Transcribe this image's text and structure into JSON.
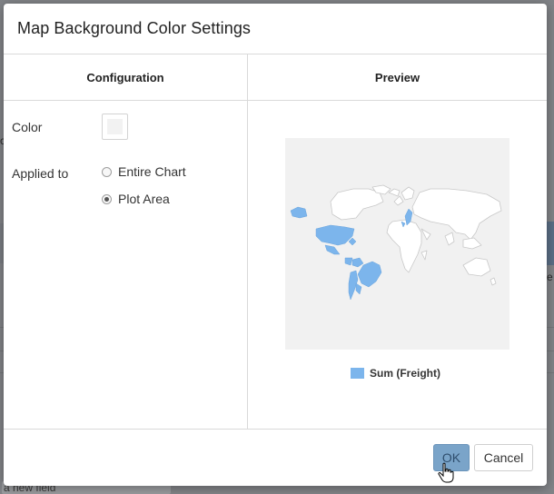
{
  "backdrop": {
    "left_text": "c",
    "right_text": "e",
    "bottom_text": "a new field"
  },
  "dialog": {
    "title": "Map Background Color Settings",
    "configuration": {
      "header": "Configuration",
      "color_label": "Color",
      "color_value": "#f2f2f2",
      "applied_to_label": "Applied to",
      "options": [
        {
          "label": "Entire Chart",
          "checked": false
        },
        {
          "label": "Plot Area",
          "checked": true
        }
      ]
    },
    "preview": {
      "header": "Preview",
      "map_background": "#f1f1f1",
      "highlight_color": "#7cb5ec",
      "legend_label": "Sum (Freight)"
    },
    "buttons": {
      "ok": "OK",
      "cancel": "Cancel"
    }
  }
}
